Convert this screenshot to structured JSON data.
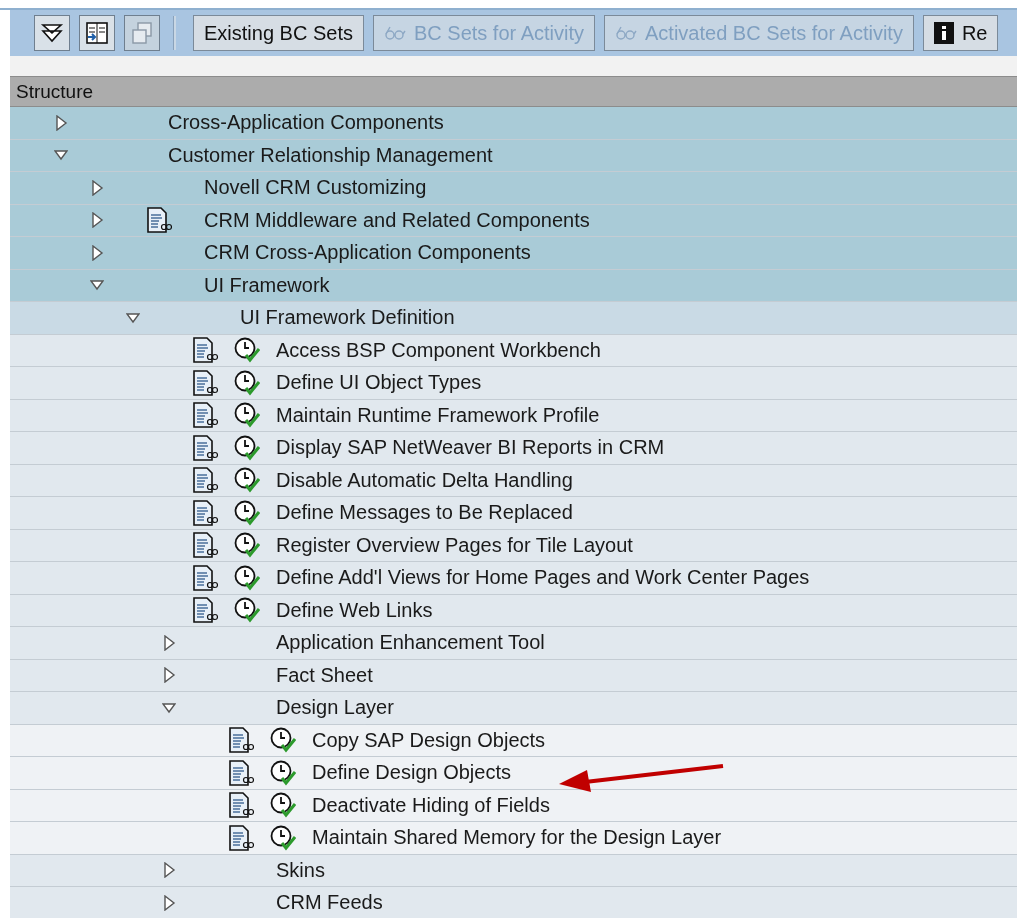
{
  "toolbar": {
    "icon_buttons": [
      {
        "kind": "expand",
        "disabled": false
      },
      {
        "kind": "import",
        "disabled": false
      },
      {
        "kind": "export",
        "disabled": true
      }
    ],
    "buttons": [
      {
        "label": "Existing BC Sets",
        "disabled": false,
        "kind": "text"
      },
      {
        "label": "BC Sets for Activity",
        "disabled": true,
        "kind": "glasses"
      },
      {
        "label": "Activated BC Sets for Activity",
        "disabled": true,
        "kind": "glasses"
      },
      {
        "label": "Re",
        "disabled": false,
        "kind": "info"
      }
    ]
  },
  "structure": {
    "header": "Structure",
    "tree": [
      {
        "kind": "folder",
        "label": "Cross-Application Components",
        "expanded": false,
        "doc_icon": false
      },
      {
        "kind": "folder",
        "label": "Customer Relationship Management",
        "expanded": true,
        "doc_icon": false,
        "children": [
          {
            "kind": "folder",
            "label": "Novell CRM Customizing",
            "expanded": false,
            "doc_icon": false
          },
          {
            "kind": "folder",
            "label": "CRM Middleware and Related Components",
            "expanded": false,
            "doc_icon": true
          },
          {
            "kind": "folder",
            "label": "CRM Cross-Application Components",
            "expanded": false,
            "doc_icon": false
          },
          {
            "kind": "folder",
            "label": "UI Framework",
            "expanded": true,
            "doc_icon": false,
            "children": [
              {
                "kind": "folder",
                "label": "UI Framework Definition",
                "expanded": true,
                "doc_icon": false,
                "children": [
                  {
                    "kind": "activity",
                    "label": "Access BSP Component Workbench"
                  },
                  {
                    "kind": "activity",
                    "label": "Define UI Object Types"
                  },
                  {
                    "kind": "activity",
                    "label": "Maintain Runtime Framework Profile"
                  },
                  {
                    "kind": "activity",
                    "label": "Display SAP NetWeaver BI Reports in CRM"
                  },
                  {
                    "kind": "activity",
                    "label": "Disable Automatic Delta Handling"
                  },
                  {
                    "kind": "activity",
                    "label": "Define Messages to Be Replaced"
                  },
                  {
                    "kind": "activity",
                    "label": "Register Overview Pages for Tile Layout"
                  },
                  {
                    "kind": "activity",
                    "label": "Define Add'l Views for Home Pages and Work Center Pages"
                  },
                  {
                    "kind": "activity",
                    "label": "Define Web Links"
                  },
                  {
                    "kind": "folder",
                    "label": "Application Enhancement Tool",
                    "expanded": false,
                    "doc_icon": false
                  },
                  {
                    "kind": "folder",
                    "label": "Fact Sheet",
                    "expanded": false,
                    "doc_icon": false
                  },
                  {
                    "kind": "folder",
                    "label": "Design Layer",
                    "expanded": true,
                    "doc_icon": false,
                    "children": [
                      {
                        "kind": "activity",
                        "label": "Copy SAP Design Objects"
                      },
                      {
                        "kind": "activity",
                        "label": "Define Design Objects"
                      },
                      {
                        "kind": "activity",
                        "label": "Deactivate Hiding of Fields"
                      },
                      {
                        "kind": "activity",
                        "label": "Maintain Shared Memory for the Design Layer"
                      }
                    ]
                  },
                  {
                    "kind": "folder",
                    "label": "Skins",
                    "expanded": false,
                    "doc_icon": false
                  },
                  {
                    "kind": "folder",
                    "label": "CRM Feeds",
                    "expanded": false,
                    "doc_icon": false
                  }
                ]
              }
            ]
          }
        ]
      }
    ]
  }
}
